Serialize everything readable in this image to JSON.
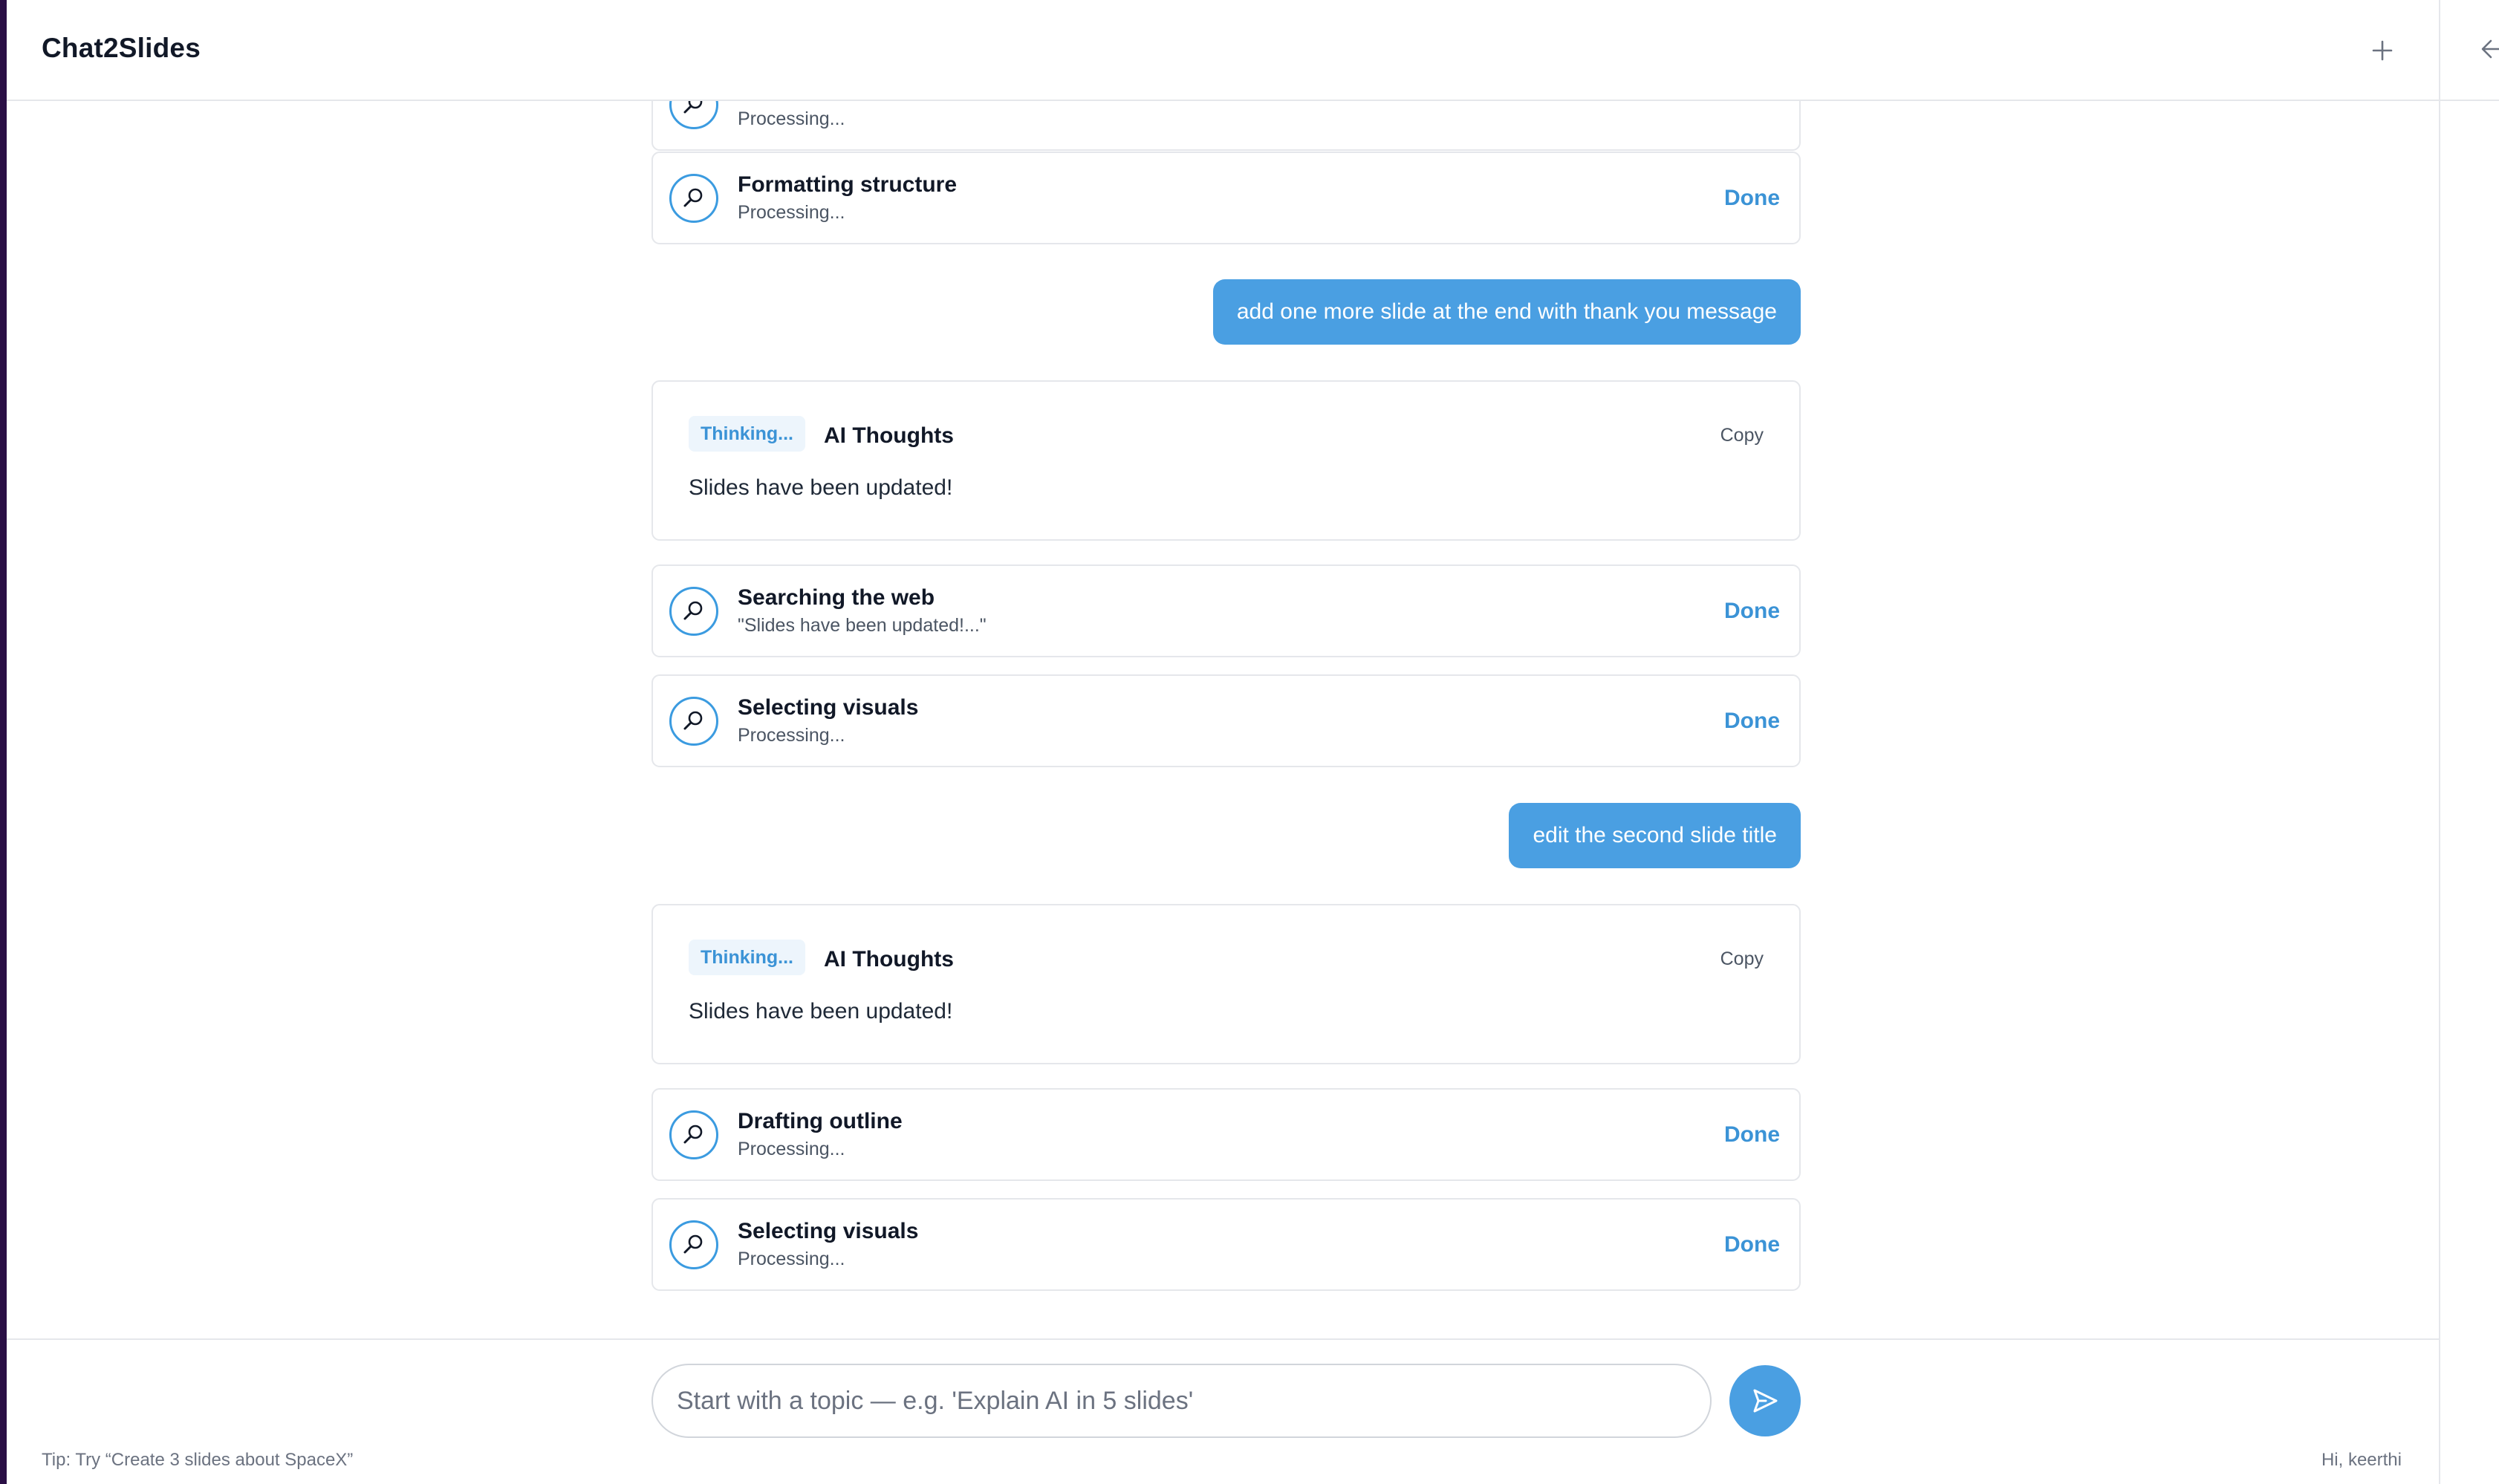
{
  "app": {
    "title": "Chat2Slides"
  },
  "header": {
    "new_icon": "plus-icon",
    "collapse_icon": "arrow-left-icon"
  },
  "chat": {
    "partial_step": {
      "sub": "Processing..."
    },
    "steps_a": [
      {
        "title": "Formatting structure",
        "sub": "Processing...",
        "status": "Done"
      }
    ],
    "user_msg_1": "add one more slide at the end with thank you message",
    "thought_1": {
      "badge": "Thinking...",
      "label": "AI Thoughts",
      "copy": "Copy",
      "body": "Slides have been updated!"
    },
    "steps_b": [
      {
        "title": "Searching the web",
        "sub": "\"Slides have been updated!...\"",
        "status": "Done"
      },
      {
        "title": "Selecting visuals",
        "sub": "Processing...",
        "status": "Done"
      }
    ],
    "user_msg_2": "edit the second slide title",
    "thought_2": {
      "badge": "Thinking...",
      "label": "AI Thoughts",
      "copy": "Copy",
      "body": "Slides have been updated!"
    },
    "steps_c": [
      {
        "title": "Drafting outline",
        "sub": "Processing...",
        "status": "Done"
      },
      {
        "title": "Selecting visuals",
        "sub": "Processing...",
        "status": "Done"
      }
    ]
  },
  "composer": {
    "placeholder": "Start with a topic — e.g. 'Explain AI in 5 slides'",
    "value": "",
    "send_icon": "send-icon",
    "tip": "Tip: Try “Create 3 slides about SpaceX”",
    "greeting": "Hi, keerthi"
  },
  "colors": {
    "accent": "#4a9fe2",
    "done": "#3b93d6",
    "sidebar_strip": "#2a0f45"
  }
}
